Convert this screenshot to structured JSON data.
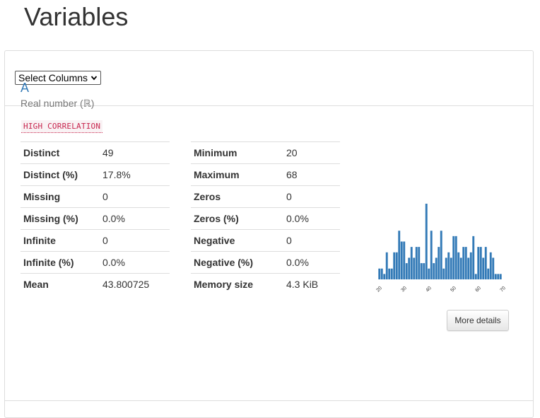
{
  "page": {
    "title": "Variables"
  },
  "controls": {
    "select_label": "Select Columns"
  },
  "variable": {
    "name": "A",
    "type": "Real number (ℝ)",
    "badge": "HIGH CORRELATION",
    "stats_left": [
      {
        "key": "Distinct",
        "value": "49"
      },
      {
        "key": "Distinct (%)",
        "value": "17.8%"
      },
      {
        "key": "Missing",
        "value": "0"
      },
      {
        "key": "Missing (%)",
        "value": "0.0%"
      },
      {
        "key": "Infinite",
        "value": "0"
      },
      {
        "key": "Infinite (%)",
        "value": "0.0%"
      },
      {
        "key": "Mean",
        "value": "43.800725"
      }
    ],
    "stats_right": [
      {
        "key": "Minimum",
        "value": "20"
      },
      {
        "key": "Maximum",
        "value": "68"
      },
      {
        "key": "Zeros",
        "value": "0"
      },
      {
        "key": "Zeros (%)",
        "value": "0.0%"
      },
      {
        "key": "Negative",
        "value": "0"
      },
      {
        "key": "Negative (%)",
        "value": "0.0%"
      },
      {
        "key": "Memory size",
        "value": "4.3 KiB"
      }
    ],
    "more_details_label": "More details"
  },
  "chart_data": {
    "type": "bar",
    "bar_color": "#337ab7",
    "xlim": [
      20,
      70
    ],
    "x_ticks": [
      "20",
      "30",
      "40",
      "50",
      "60",
      "70"
    ],
    "x": [
      20,
      21,
      22,
      23,
      24,
      25,
      26,
      27,
      28,
      29,
      30,
      31,
      32,
      33,
      34,
      35,
      36,
      37,
      38,
      39,
      40,
      41,
      42,
      43,
      44,
      45,
      46,
      47,
      48,
      49,
      50,
      51,
      52,
      53,
      54,
      55,
      56,
      57,
      58,
      59,
      60,
      61,
      62,
      63,
      64,
      65,
      66,
      67,
      68,
      69
    ],
    "values": [
      2,
      2,
      1,
      5,
      2,
      2,
      5,
      5,
      9,
      7,
      7,
      3,
      4,
      6,
      4,
      6,
      6,
      3,
      3,
      14,
      2,
      9,
      3,
      4,
      6,
      9,
      2,
      4,
      5,
      4,
      8,
      8,
      5,
      4,
      6,
      6,
      4,
      5,
      8,
      1,
      6,
      6,
      4,
      6,
      2,
      5,
      4,
      1,
      1,
      1
    ]
  }
}
